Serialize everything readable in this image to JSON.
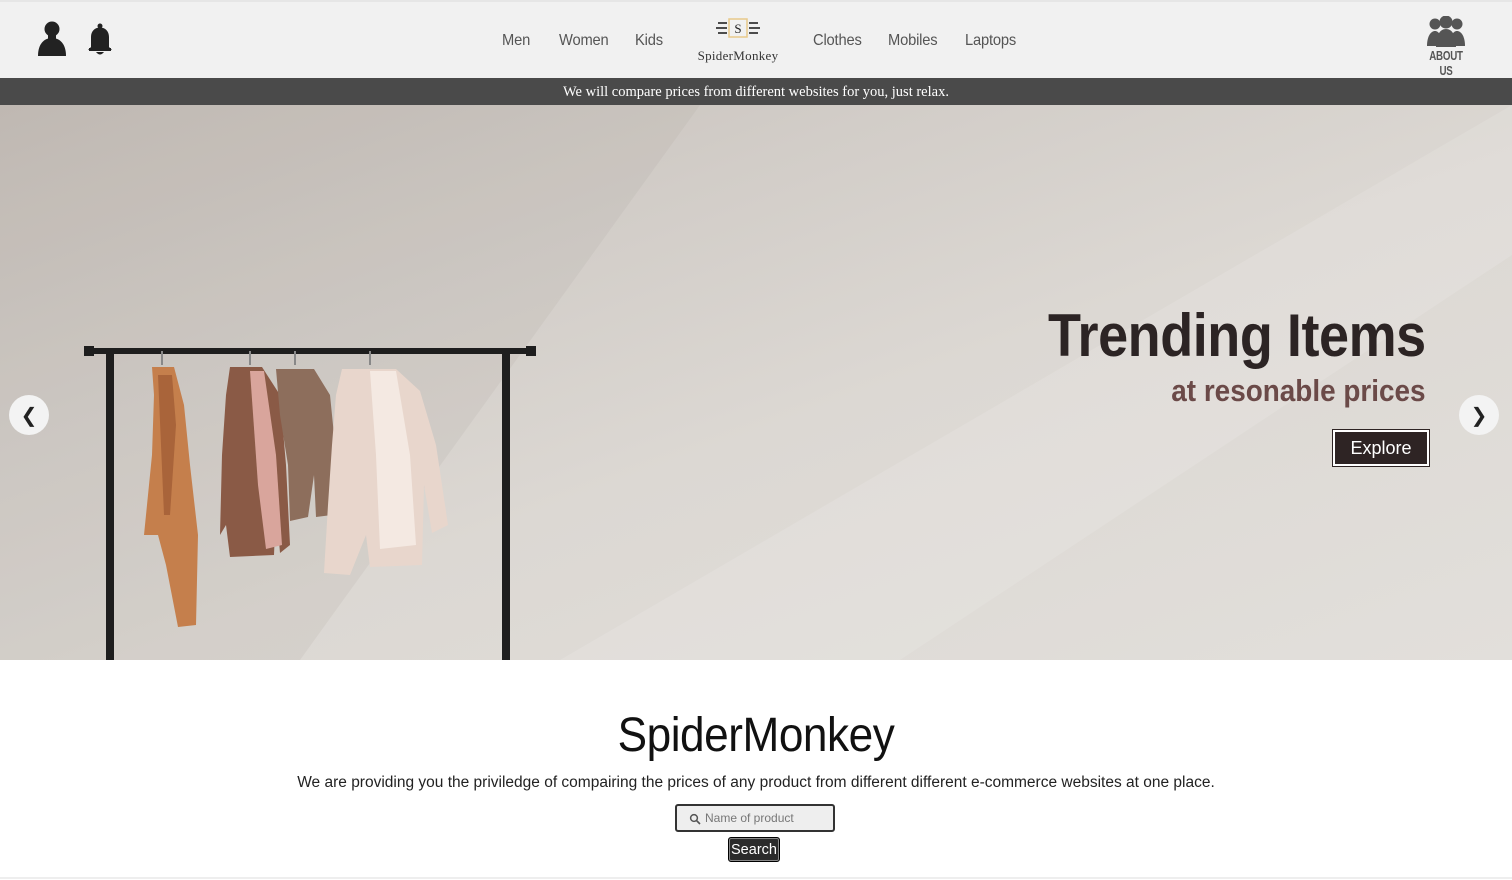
{
  "header": {
    "nav_left": [
      "Men",
      "Women",
      "Kids"
    ],
    "nav_right": [
      "Clothes",
      "Mobiles",
      "Laptops"
    ],
    "logo_letter": "S",
    "logo_text": "SpiderMonkey",
    "about_label": "ABOUT US",
    "icons": {
      "user": "user-icon",
      "notifications": "bell-icon",
      "about": "group-icon"
    }
  },
  "banner": {
    "text": "We will compare prices from different websites for you, just relax."
  },
  "hero": {
    "title": "Trending Items",
    "subtitle": "at resonable prices",
    "explore_label": "Explore",
    "prev_label": "❮",
    "next_label": "❯"
  },
  "intro": {
    "title": "SpiderMonkey",
    "description": "We are providing you the priviledge of compairing the prices of any product from different different e-commerce websites at one place."
  },
  "search": {
    "placeholder": "Name of product",
    "value": "",
    "button_label": "Search"
  },
  "colors": {
    "header_bg": "#f1f1f1",
    "banner_bg": "#4a4a4a",
    "title_dark": "#2c2424",
    "subtitle_brown": "#6b4a48",
    "logo_accent": "#e8c98a"
  }
}
